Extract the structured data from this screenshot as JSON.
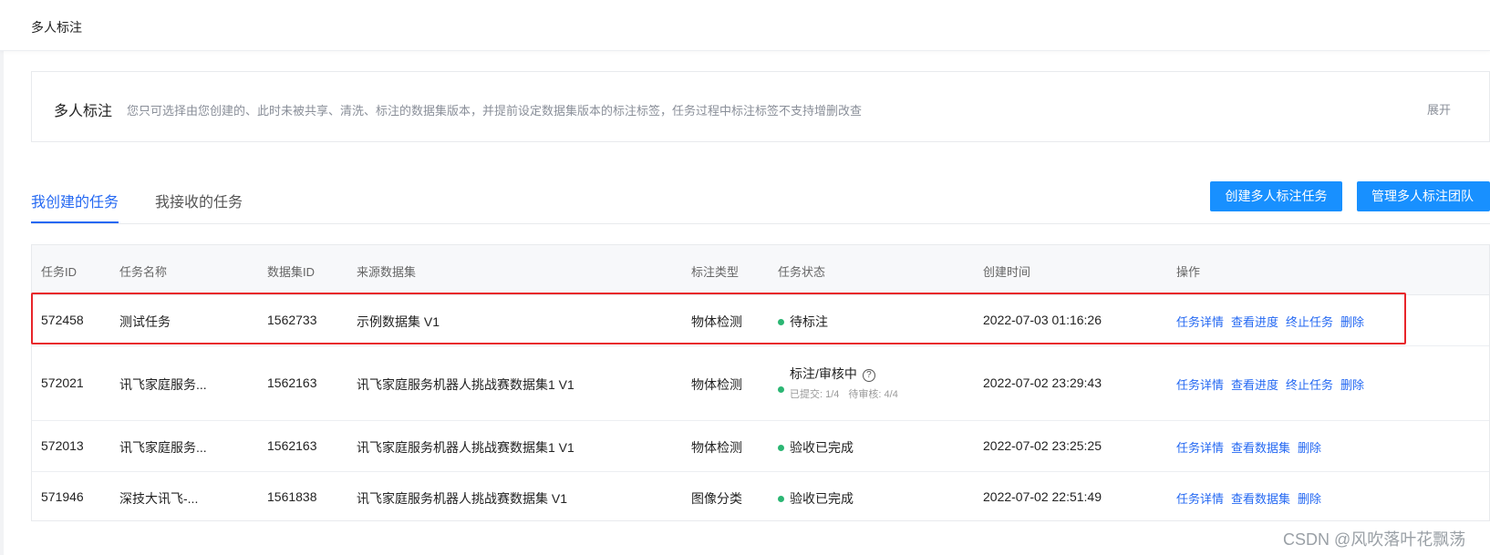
{
  "topbar": {
    "title": "多人标注"
  },
  "info": {
    "title": "多人标注",
    "description": "您只可选择由您创建的、此时未被共享、清洗、标注的数据集版本，并提前设定数据集版本的标注标签，任务过程中标注标签不支持增删改查",
    "expand_label": "展开"
  },
  "tabs": [
    {
      "label": "我创建的任务",
      "active": true
    },
    {
      "label": "我接收的任务",
      "active": false
    }
  ],
  "buttons": {
    "create_label": "创建多人标注任务",
    "team_label": "管理多人标注团队"
  },
  "table": {
    "headers": {
      "id": "任务ID",
      "name": "任务名称",
      "dataset_id": "数据集ID",
      "source": "来源数据集",
      "type": "标注类型",
      "status": "任务状态",
      "created": "创建时间",
      "ops": "操作"
    },
    "rows": [
      {
        "id": "572458",
        "name": "测试任务",
        "dataset_id": "1562733",
        "source": "示例数据集 V1",
        "type": "物体检测",
        "status": "待标注",
        "created": "2022-07-03 01:16:26",
        "ops": [
          "任务详情",
          "查看进度",
          "终止任务",
          "删除"
        ]
      },
      {
        "id": "572021",
        "name": "讯飞家庭服务...",
        "dataset_id": "1562163",
        "source": "讯飞家庭服务机器人挑战赛数据集1 V1",
        "type": "物体检测",
        "status": "标注/审核中",
        "submitted": "已提交: 1/4",
        "pending": "待审核: 4/4",
        "created": "2022-07-02 23:29:43",
        "ops": [
          "任务详情",
          "查看进度",
          "终止任务",
          "删除"
        ]
      },
      {
        "id": "572013",
        "name": "讯飞家庭服务...",
        "dataset_id": "1562163",
        "source": "讯飞家庭服务机器人挑战赛数据集1 V1",
        "type": "物体检测",
        "status": "验收已完成",
        "created": "2022-07-02 23:25:25",
        "ops": [
          "任务详情",
          "查看数据集",
          "删除"
        ]
      },
      {
        "id": "571946",
        "name": "深技大讯飞-...",
        "dataset_id": "1561838",
        "source": "讯飞家庭服务机器人挑战赛数据集 V1",
        "type": "图像分类",
        "status": "验收已完成",
        "created": "2022-07-02 22:51:49",
        "ops": [
          "任务详情",
          "查看数据集",
          "删除"
        ]
      }
    ]
  },
  "watermark": "CSDN @风吹落叶花飘荡",
  "colors": {
    "accent": "#2468f2",
    "button": "#1890ff",
    "status_ok": "#2bb673",
    "highlight": "#e8252a"
  }
}
